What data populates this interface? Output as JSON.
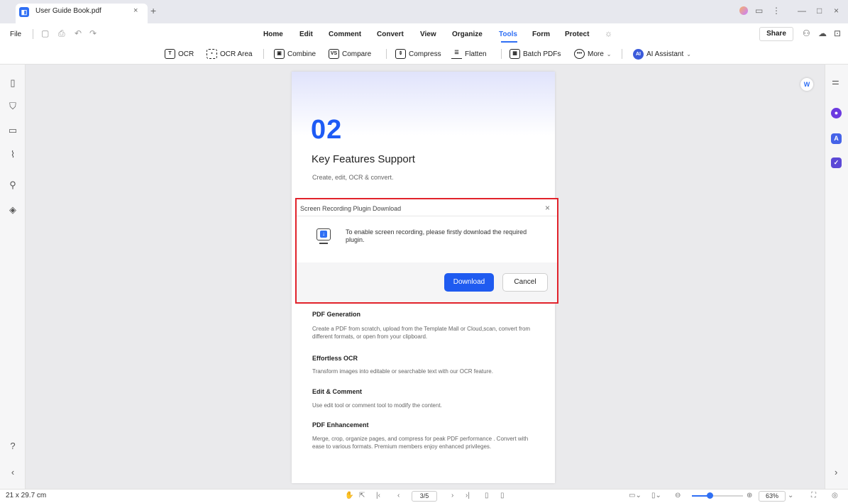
{
  "titlebar": {
    "tab_title": "User Guide Book.pdf",
    "tab_close": "×",
    "new_tab": "+",
    "window_controls": [
      "—",
      "□",
      "×"
    ]
  },
  "menubar": {
    "file": "File",
    "items": [
      "Home",
      "Edit",
      "Comment",
      "Convert",
      "View",
      "Organize",
      "Tools",
      "Form",
      "Protect"
    ],
    "active": "Tools",
    "share": "Share"
  },
  "toolbar": {
    "ocr": "OCR",
    "ocr_area": "OCR Area",
    "combine": "Combine",
    "compare": "Compare",
    "compress": "Compress",
    "flatten": "Flatten",
    "batch": "Batch PDFs",
    "more": "More",
    "ai_assistant": "AI Assistant",
    "ai_badge": "AI"
  },
  "document": {
    "chapter_number": "02",
    "chapter_title": "Key Features Support",
    "chapter_subtitle": "Create, edit, OCR & convert.",
    "features": [
      {
        "title": "PDF Generation",
        "desc": "Create a PDF from scratch, upload from the Template Mall or Cloud,scan, convert from different formats, or open from your clipboard."
      },
      {
        "title": "Effortless OCR",
        "desc": "Transform images into editable or searchable text with our OCR feature."
      },
      {
        "title": "Edit & Comment",
        "desc": "Use edit tool or comment tool to modify the content."
      },
      {
        "title": "PDF Enhancement",
        "desc": "Merge, crop, organize pages, and compress for peak PDF performance . Convert with ease to various formats. Premium members enjoy enhanced privileges."
      }
    ]
  },
  "dialog": {
    "title": "Screen Recording Plugin Download",
    "close": "×",
    "message": "To enable screen recording, please firstly download the required plugin.",
    "download": "Download",
    "cancel": "Cancel"
  },
  "statusbar": {
    "page_size": "21 x 29.7 cm",
    "page_indicator": "3/5",
    "zoom": "63%",
    "zoom_level": 0.35
  },
  "colors": {
    "accent": "#1f5bf0",
    "highlight": "#e1222b"
  }
}
